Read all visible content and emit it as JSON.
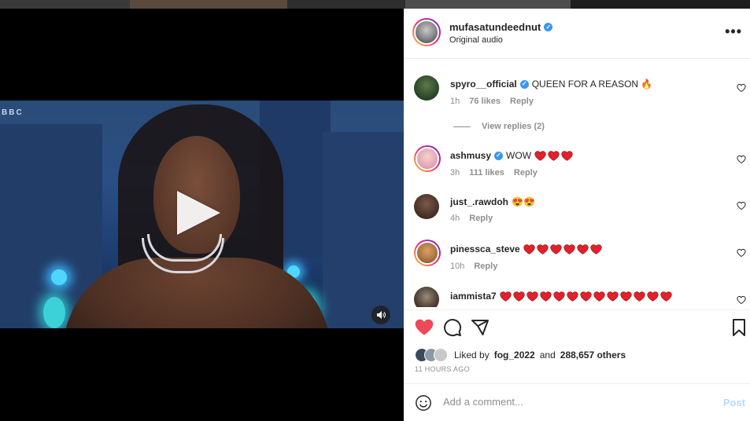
{
  "header": {
    "username": "mufasatundeednut",
    "subtitle": "Original audio",
    "more_label": "•••"
  },
  "video": {
    "watermark": "BBC"
  },
  "comments": [
    {
      "user": "spyro__official",
      "verified": true,
      "text": "QUEEN FOR A REASON 🔥",
      "time": "1h",
      "likes": "76 likes",
      "reply": "Reply"
    },
    {
      "user": "ashmusy",
      "verified": true,
      "text": "WOW",
      "heart_count": 3,
      "time": "3h",
      "likes": "111 likes",
      "reply": "Reply"
    },
    {
      "user": "just_.rawdoh",
      "verified": false,
      "text": "😍😍",
      "time": "4h",
      "likes": "",
      "reply": "Reply"
    },
    {
      "user": "pinessca_steve",
      "verified": false,
      "text": "",
      "heart_count": 6,
      "time": "10h",
      "likes": "",
      "reply": "Reply"
    },
    {
      "user": "iammista7",
      "verified": false,
      "text": "",
      "heart_count": 13,
      "time": "",
      "likes": "",
      "reply": ""
    }
  ],
  "view_replies": "View replies (2)",
  "likes": {
    "prefix": "Liked by",
    "user": "fog_2022",
    "middle": "and",
    "count": "288,657 others"
  },
  "timestamp": "11 HOURS AGO",
  "add_comment": {
    "placeholder": "Add a comment...",
    "post_label": "Post"
  },
  "colors": {
    "like_red": "#ed4956",
    "verified_blue": "#3897f0",
    "post_disabled": "#b3dbff"
  }
}
